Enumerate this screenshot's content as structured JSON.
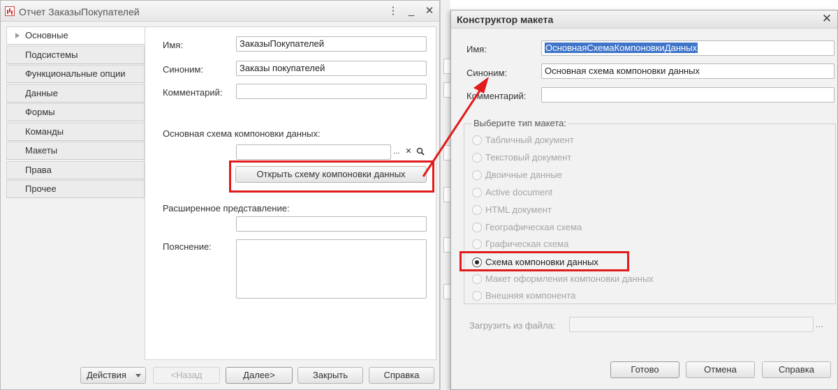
{
  "left_window": {
    "title": "Отчет ЗаказыПокупателей",
    "tabs": [
      "Основные",
      "Подсистемы",
      "Функциональные опции",
      "Данные",
      "Формы",
      "Команды",
      "Макеты",
      "Права",
      "Прочее"
    ],
    "fields": {
      "name_label": "Имя:",
      "name_value": "ЗаказыПокупателей",
      "synonym_label": "Синоним:",
      "synonym_value": "Заказы покупателей",
      "comment_label": "Комментарий:",
      "comment_value": "",
      "main_schema_label": "Основная схема компоновки данных:",
      "main_schema_value": "",
      "open_schema_button": "Открыть схему компоновки данных",
      "extended_label": "Расширенное представление:",
      "explanation_label": "Пояснение:"
    },
    "select_buttons": {
      "ellipsis": "...",
      "clear": "✕",
      "search": "🔍"
    },
    "bottom_buttons": {
      "actions": "Действия",
      "back": "<Назад",
      "next": "Далее>",
      "close": "Закрыть",
      "help": "Справка"
    }
  },
  "right_window": {
    "title": "Конструктор макета",
    "name_label": "Имя:",
    "name_value": "ОсновнаяСхемаКомпоновкиДанных",
    "synonym_label": "Синоним:",
    "synonym_value": "Основная схема компоновки данных",
    "comment_label": "Комментарий:",
    "comment_value": "",
    "group_title": "Выберите тип макета:",
    "layout_types": [
      "Табличный документ",
      "Текстовый документ",
      "Двоичные данные",
      "Active document",
      "HTML документ",
      "Географическая схема",
      "Графическая схема",
      "Схема компоновки данных",
      "Макет оформления компоновки данных",
      "Внешняя компонента"
    ],
    "selected_layout_type": "Схема компоновки данных",
    "load_from_file_label": "Загрузить из файла:",
    "load_from_file_button": "...",
    "buttons": {
      "ok": "Готово",
      "cancel": "Отмена",
      "help": "Справка"
    }
  },
  "colors": {
    "highlight": "#e11b1b",
    "selection": "#3e74c9"
  },
  "icons": {
    "app": "report-icon",
    "minimize": "minimize-icon",
    "maximize": "maximize-icon",
    "close": "close-icon"
  }
}
